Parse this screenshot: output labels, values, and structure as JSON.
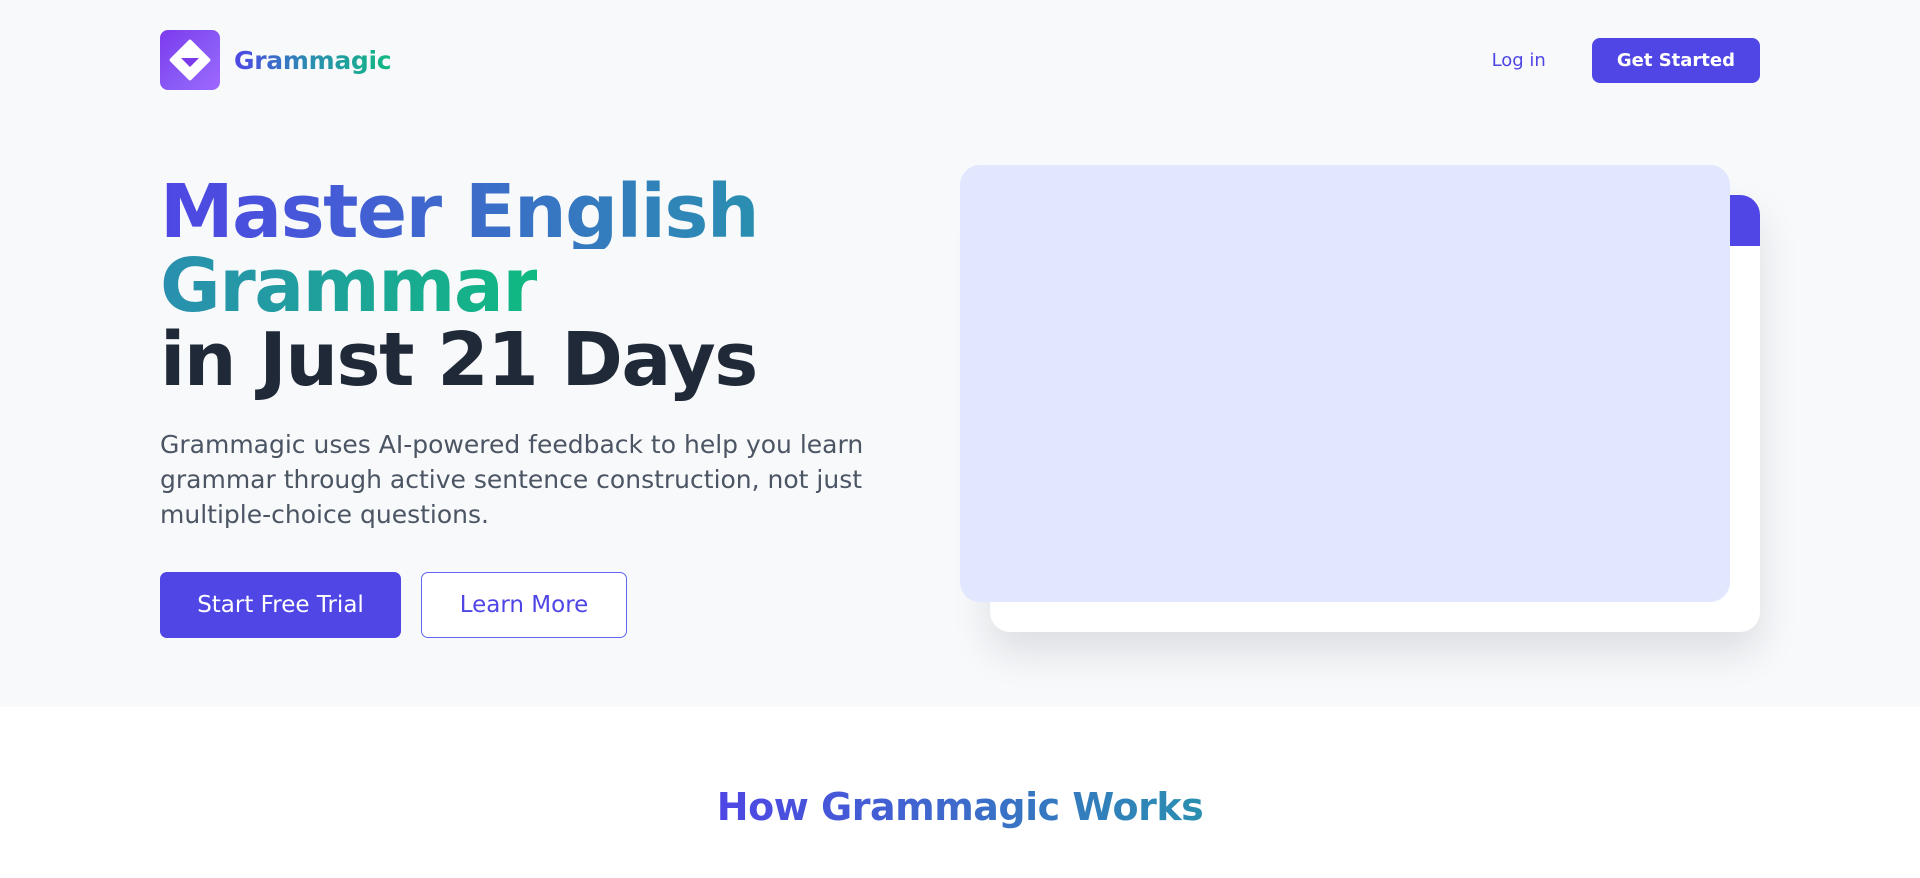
{
  "brand": {
    "name": "Grammagic",
    "logo_icon": "diamond-logo-icon"
  },
  "nav": {
    "login": "Log in",
    "get_started": "Get Started"
  },
  "hero": {
    "headline_line1": "Master English",
    "headline_line2": "Grammar",
    "headline_line3": "in Just 21 Days",
    "subtitle": "Grammagic uses AI-powered feedback to help you learn grammar through active sentence construction, not just multiple-choice questions.",
    "cta_primary": "Start Free Trial",
    "cta_secondary": "Learn More"
  },
  "how_it_works": {
    "title": "How Grammagic Works"
  },
  "colors": {
    "accent": "#4f46e5",
    "teal": "#10b981",
    "mock_bg": "#e0e7ff",
    "page_bg": "#f8f9fb"
  }
}
